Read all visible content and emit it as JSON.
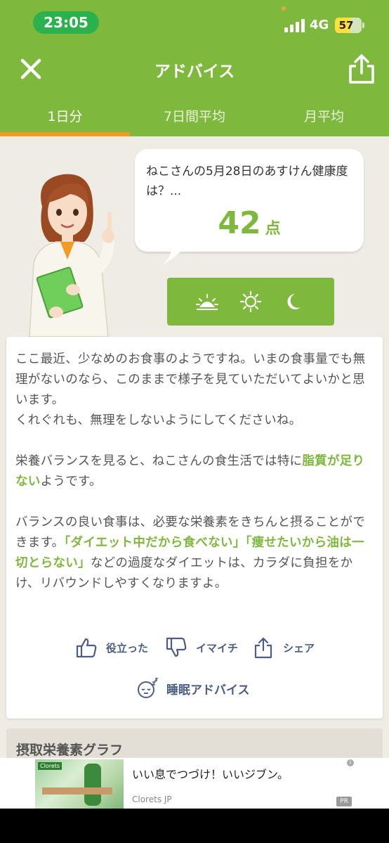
{
  "status_bar": {
    "time": "23:05",
    "network": "4G",
    "battery_level": "57",
    "battery_fraction": 0.57
  },
  "header": {
    "title": "アドバイス",
    "close_icon": "close-icon",
    "share_icon": "share-icon"
  },
  "tabs": [
    {
      "label": "1日分",
      "selected": true
    },
    {
      "label": "7日間平均",
      "selected": false
    },
    {
      "label": "月平均",
      "selected": false
    }
  ],
  "score": {
    "question": "ねこさんの5月28日のあすけん健康度は？...",
    "value": "42",
    "unit": "点"
  },
  "time_of_day_icons": [
    "sunrise-icon",
    "sun-icon",
    "moon-icon"
  ],
  "advice": {
    "p1": "ここ最近、少なめのお食事のようですね。いまの食事量でも無理がないのなら、このままで様子を見ていただいてよいかと思います。",
    "p1b": "くれぐれも、無理をしないようにしてくださいね。",
    "p2_before": "栄養バランスを見ると、ねこさんの食生活では特に",
    "p2_highlight": "脂質が足りない",
    "p2_after": "ようです。",
    "p3_before": "バランスの良い食事は、必要な栄養素をきちんと摂ることができます。",
    "p3_highlight": "「ダイエット中だから食べない」「痩せたいから油は一切とらない」",
    "p3_after": "などの過度なダイエットは、カラダに負担をかけ、リバウンドしやすくなりますよ。"
  },
  "actions": {
    "helpful": "役立った",
    "not_good": "イマイチ",
    "share": "シェア",
    "sleep": "睡眠アドバイス"
  },
  "section": {
    "nutrient_graph_title": "摂取栄養素グラフ"
  },
  "ad": {
    "title": "いい息でつづけ！いいジブン。",
    "sponsor": "Clorets JP",
    "pr_label": "PR",
    "logo": "Clorets",
    "info": "i"
  },
  "colors": {
    "brand_green": "#7eb83c",
    "tab_indicator": "#f39a24",
    "action_text": "#4b5d86",
    "background": "#efece6"
  }
}
